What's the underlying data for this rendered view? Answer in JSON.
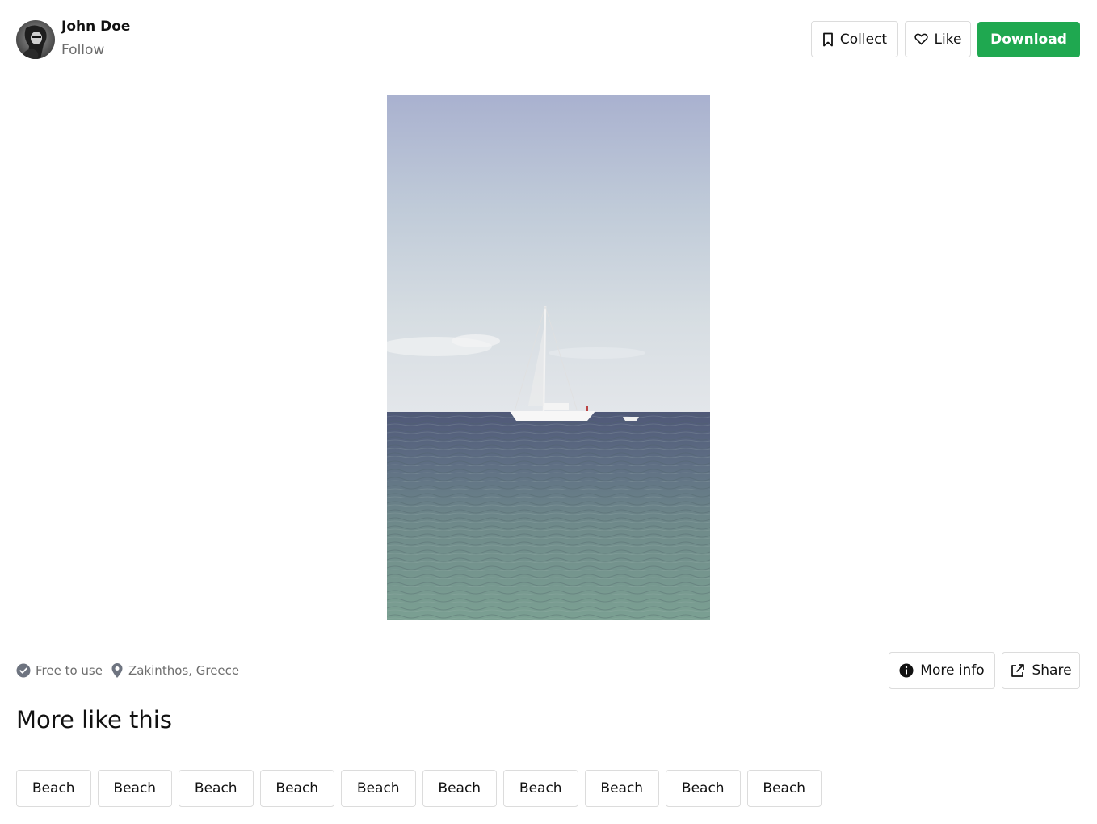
{
  "author": {
    "name": "John Doe",
    "follow_label": "Follow"
  },
  "actions": {
    "collect_label": "Collect",
    "like_label": "Like",
    "download_label": "Download",
    "download_color": "#1fa850"
  },
  "photo": {
    "subject": "sailboat on the sea"
  },
  "meta": {
    "license_label": "Free to use",
    "location": "Zakinthos, Greece"
  },
  "info_actions": {
    "more_info_label": "More info",
    "share_label": "Share"
  },
  "related": {
    "title": "More like this",
    "tags": [
      "Beach",
      "Beach",
      "Beach",
      "Beach",
      "Beach",
      "Beach",
      "Beach",
      "Beach",
      "Beach",
      "Beach"
    ]
  },
  "icons": [
    "avatar",
    "bookmark-icon",
    "heart-icon",
    "check-badge-icon",
    "location-pin-icon",
    "info-icon",
    "external-link-icon"
  ]
}
